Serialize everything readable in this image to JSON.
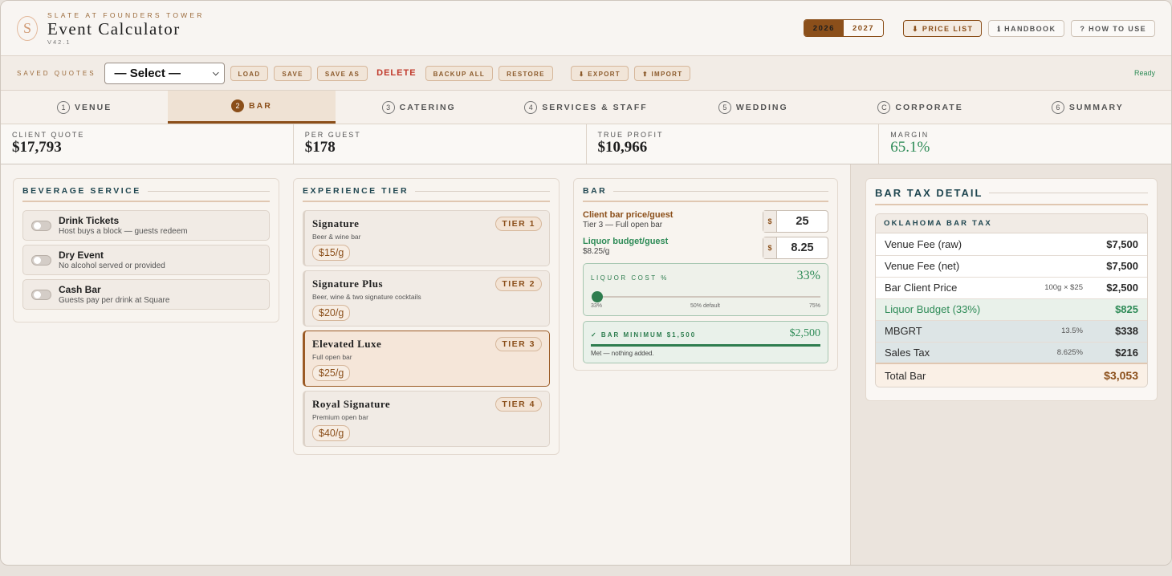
{
  "header": {
    "subtitle": "SLATE AT FOUNDERS TOWER",
    "title": "Event Calculator",
    "version": "V42.1",
    "logo_letter": "S",
    "years": [
      "2026",
      "2027"
    ],
    "active_year": "2026",
    "buttons": {
      "price_list": "⬇ PRICE LIST",
      "handbook": "ℹ HANDBOOK",
      "how_to_use": "? HOW TO USE"
    }
  },
  "toolbar": {
    "label": "SAVED QUOTES",
    "select_value": "— Select —",
    "load": "LOAD",
    "save": "SAVE",
    "save_as": "SAVE AS",
    "delete": "DELETE",
    "backup_all": "BACKUP ALL",
    "restore": "RESTORE",
    "export": "⬇ EXPORT",
    "import": "⬆ IMPORT",
    "status": "Ready"
  },
  "tabs": [
    {
      "num": "1",
      "label": "VENUE"
    },
    {
      "num": "2",
      "label": "BAR"
    },
    {
      "num": "3",
      "label": "CATERING"
    },
    {
      "num": "4",
      "label": "SERVICES & STAFF"
    },
    {
      "num": "5",
      "label": "WEDDING"
    },
    {
      "num": "C",
      "label": "CORPORATE"
    },
    {
      "num": "6",
      "label": "SUMMARY"
    }
  ],
  "stats": {
    "client_quote": {
      "label": "CLIENT QUOTE",
      "value": "$17,793"
    },
    "per_guest": {
      "label": "PER GUEST",
      "value": "$178"
    },
    "true_profit": {
      "label": "TRUE PROFIT",
      "value": "$10,966"
    },
    "margin": {
      "label": "MARGIN",
      "value": "65.1%"
    }
  },
  "beverage": {
    "title": "BEVERAGE SERVICE",
    "options": [
      {
        "title": "Drink Tickets",
        "desc": "Host buys a block — guests redeem"
      },
      {
        "title": "Dry Event",
        "desc": "No alcohol served or provided"
      },
      {
        "title": "Cash Bar",
        "desc": "Guests pay per drink at Square"
      }
    ]
  },
  "tiers": {
    "title": "EXPERIENCE TIER",
    "items": [
      {
        "name": "Signature",
        "desc": "Beer & wine bar",
        "price": "$15/g",
        "badge": "TIER 1"
      },
      {
        "name": "Signature Plus",
        "desc": "Beer, wine & two signature cocktails",
        "price": "$20/g",
        "badge": "TIER 2"
      },
      {
        "name": "Elevated Luxe",
        "desc": "Full open bar",
        "price": "$25/g",
        "badge": "TIER 3"
      },
      {
        "name": "Royal Signature",
        "desc": "Premium open bar",
        "price": "$40/g",
        "badge": "TIER 4"
      }
    ]
  },
  "bar": {
    "title": "BAR",
    "client_price": {
      "label": "Client bar price/guest",
      "sub": "Tier 3 — Full open bar",
      "currency": "$",
      "value": "25"
    },
    "liquor_budget": {
      "label": "Liquor budget/guest",
      "sub": "$8.25/g",
      "currency": "$",
      "value": "8.25"
    },
    "liquor_cost": {
      "label": "LIQUOR COST %",
      "value": "33%",
      "min": "33%",
      "mid": "50% default",
      "max": "75%",
      "level_percent": 33
    },
    "minimum": {
      "label": "✓ BAR MINIMUM $1,500",
      "value": "$2,500",
      "note": "Met — nothing added.",
      "progress": 1.0
    }
  },
  "tax": {
    "title": "BAR TAX DETAIL",
    "subtitle": "OKLAHOMA BAR TAX",
    "rows": [
      {
        "label": "Venue Fee (raw)",
        "mid": "",
        "amount": "$7,500"
      },
      {
        "label": "Venue Fee (net)",
        "mid": "",
        "amount": "$7,500"
      },
      {
        "label": "Bar Client Price",
        "mid": "100g × $25",
        "amount": "$2,500"
      },
      {
        "label": "Liquor Budget (33%)",
        "mid": "",
        "amount": "$825"
      },
      {
        "label": "MBGRT",
        "mid": "13.5%",
        "amount": "$338"
      },
      {
        "label": "Sales Tax",
        "mid": "8.625%",
        "amount": "$216"
      },
      {
        "label": "Total Bar",
        "mid": "",
        "amount": "$3,053"
      }
    ]
  },
  "colors": {
    "accent": "#8b4f1a",
    "green": "#2e8b57",
    "teal": "#1f4650"
  }
}
